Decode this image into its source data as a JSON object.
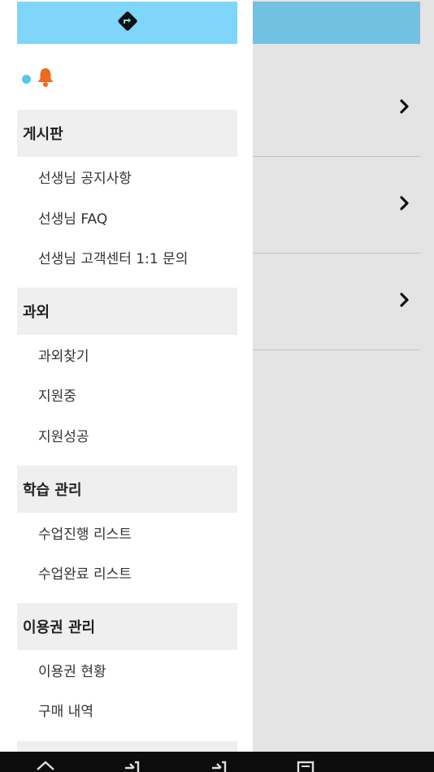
{
  "drawer": {
    "header_icon": "directions-icon",
    "notify_icon": "bell-icon",
    "sections": [
      {
        "title": "게시판",
        "items": [
          "선생님 공지사항",
          "선생님 FAQ",
          "선생님 고객센터 1:1 문의"
        ]
      },
      {
        "title": "과외",
        "items": [
          "과외찾기",
          "지원중",
          "지원성공"
        ]
      },
      {
        "title": "학습 관리",
        "items": [
          "수업진행 리스트",
          "수업완료 리스트"
        ]
      },
      {
        "title": "이용권 관리",
        "items": [
          "이용권 현황",
          "구매 내역"
        ]
      }
    ]
  },
  "colors": {
    "drawer_header": "#7fd5fa",
    "app_header": "#71c2e2",
    "bell": "#f26a1b",
    "dot": "#57c6f2"
  },
  "navbar": {
    "icons": [
      "home-icon",
      "sign-in-icon",
      "sign-in-icon",
      "document-icon"
    ]
  }
}
